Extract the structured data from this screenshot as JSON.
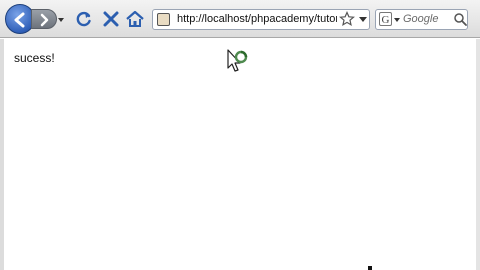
{
  "browser": {
    "address": "http://localhost/phpacademy/tutorials/lo",
    "search_engine": "Google",
    "search_engine_letter": "G"
  },
  "page": {
    "message": "sucess!"
  }
}
